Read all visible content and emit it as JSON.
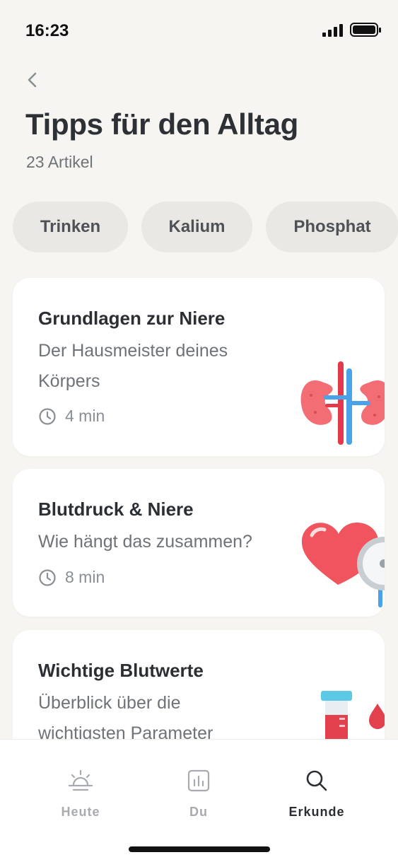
{
  "status_bar": {
    "time": "16:23"
  },
  "header": {
    "title": "Tipps für den Alltag",
    "subtitle": "23 Artikel"
  },
  "chips": [
    "Trinken",
    "Kalium",
    "Phosphat"
  ],
  "articles": [
    {
      "title": "Grundlagen zur Niere",
      "description": "Der Hausmeister deines Körpers",
      "duration": "4 min",
      "illustration": "kidneys-icon"
    },
    {
      "title": "Blutdruck & Niere",
      "description": "Wie hängt das zusammen?",
      "duration": "8 min",
      "illustration": "heart-pressure-gauge-icon"
    },
    {
      "title": "Wichtige Blutwerte",
      "description": "Überblick über die wichtigsten Parameter",
      "duration": "",
      "illustration": "blood-test-tube-icon"
    }
  ],
  "tab_bar": {
    "tabs": [
      {
        "label": "Heute",
        "icon": "sunrise-icon",
        "active": false
      },
      {
        "label": "Du",
        "icon": "chart-icon",
        "active": false
      },
      {
        "label": "Erkunde",
        "icon": "search-icon",
        "active": true
      }
    ]
  },
  "colors": {
    "background": "#f7f5f2",
    "card": "#ffffff",
    "chip": "#eae8e4",
    "accent_red": "#f0545e",
    "accent_blue": "#4aa3e8"
  }
}
